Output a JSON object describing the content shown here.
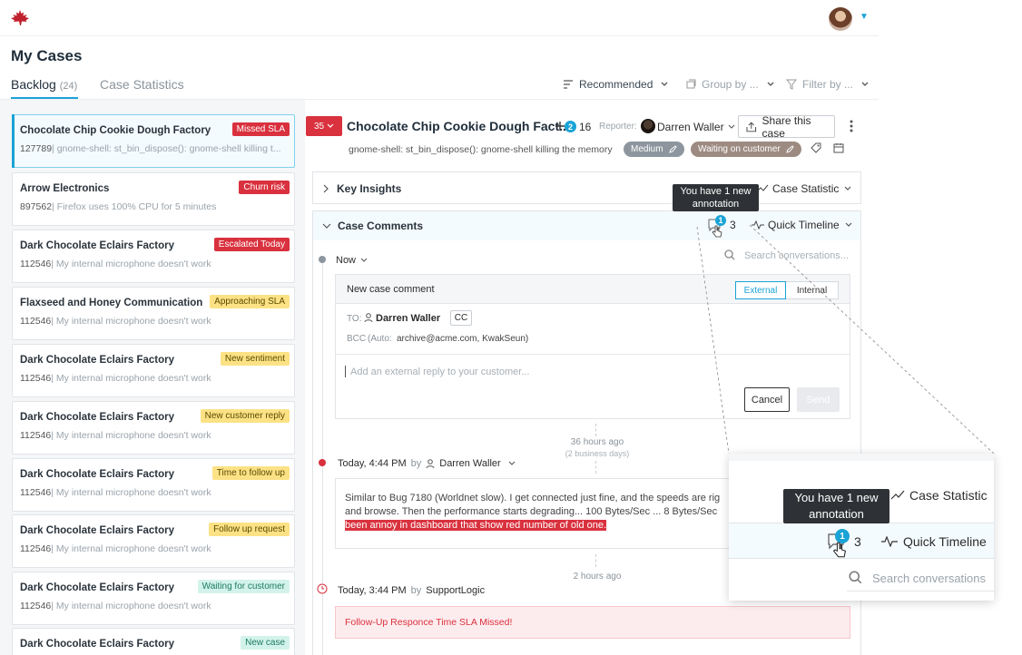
{
  "header": {
    "logo_icon": "maple-leaf-logo",
    "brand_color": "#d9313e",
    "accent_color": "#1aa3d6"
  },
  "page": {
    "title": "My Cases",
    "tabs": [
      {
        "label": "Backlog",
        "count": "(24)"
      },
      {
        "label": "Case Statistics"
      }
    ],
    "toolbar": {
      "sort_label": "Recommended",
      "group_label": "Group by ...",
      "filter_label": "Filter by ..."
    }
  },
  "cases": [
    {
      "title": "Chocolate Chip Cookie Dough Factory",
      "id": "127789",
      "desc": "gnome-shell: st_bin_dispose(): gnome-shell killing t...",
      "badge": "Missed SLA",
      "badge_type": "red"
    },
    {
      "title": "Arrow Electronics",
      "id": "897562",
      "desc": "Firefox uses 100% CPU for 5 minutes",
      "badge": "Churn risk",
      "badge_type": "red"
    },
    {
      "title": "Dark Chocolate Eclairs Factory",
      "id": "112546",
      "desc": "My internal microphone doesn't work",
      "badge": "Escalated Today",
      "badge_type": "red"
    },
    {
      "title": "Flaxseed and Honey Communication",
      "id": "112546",
      "desc": "My internal microphone doesn't work",
      "badge": "Approaching SLA",
      "badge_type": "yellow"
    },
    {
      "title": "Dark Chocolate Eclairs Factory",
      "id": "112546",
      "desc": "My internal microphone doesn't work",
      "badge": "New sentiment",
      "badge_type": "yellow"
    },
    {
      "title": "Dark Chocolate Eclairs Factory",
      "id": "112546",
      "desc": "My internal microphone doesn't work",
      "badge": "New customer reply",
      "badge_type": "yellow"
    },
    {
      "title": "Dark Chocolate Eclairs Factory",
      "id": "112546",
      "desc": "My internal microphone doesn't work",
      "badge": "Time to follow up",
      "badge_type": "yellow"
    },
    {
      "title": "Dark Chocolate Eclairs Factory",
      "id": "112546",
      "desc": "My internal microphone doesn't work",
      "badge": "Follow up request",
      "badge_type": "yellow"
    },
    {
      "title": "Dark Chocolate Eclairs Factory",
      "id": "112546",
      "desc": "My internal microphone doesn't work",
      "badge": "Waiting for customer",
      "badge_type": "green"
    },
    {
      "title": "Dark Chocolate Eclairs Factory",
      "id": "112546",
      "desc": "My internal microphone doesn't work",
      "badge": "New case",
      "badge_type": "green"
    }
  ],
  "detail": {
    "priority": "35",
    "title": "Chocolate Chip Cookie Dough Fact...",
    "watchers_badge": "2",
    "watchers_count": "16",
    "reporter_label": "Reporter:",
    "reporter_name": "Darren Waller",
    "share_label": "Share this case",
    "subtitle": "gnome-shell: st_bin_dispose(): gnome-shell killing the memory",
    "pill_severity": "Medium",
    "pill_status": "Waiting on customer",
    "key_insights_label": "Key Insights",
    "case_statistic_label": "Case Statistic",
    "case_comments_label": "Case Comments",
    "annotation_tooltip": "You have 1 new annotation",
    "annotation_badge": "1",
    "comment_count": "3",
    "quick_timeline_label": "Quick Timeline",
    "search_placeholder": "Search conversations...",
    "now_label": "Now",
    "new_comment": {
      "title": "New case comment",
      "external_label": "External",
      "internal_label": "Internal",
      "to_label": "TO:",
      "to_name": "Darren Waller",
      "cc_label": "CC",
      "bcc_label": "BCC",
      "bcc_auto": "(Auto:",
      "bcc_value": "archive@acme.com, KwakSeun)",
      "reply_placeholder": "Add an external reply to your customer...",
      "cancel_label": "Cancel",
      "send_label": "Send"
    },
    "gap1": {
      "ago": "36 hours ago",
      "business": "(2 business days)"
    },
    "event1": {
      "time": "Today, 4:44 PM",
      "by": "by",
      "author": "Darren Waller",
      "line1": "Similar to Bug 7180 (Worldnet slow).  I get connected just fine, and the speeds are rig",
      "line2": "and browse.  Then the performance starts degrading... 100 Bytes/Sec ...  8 Bytes/Sec",
      "highlight": "been annoy in dashboard that show red number of old one."
    },
    "gap2": {
      "ago": "2 hours ago"
    },
    "event2": {
      "time": "Today, 3:44 PM",
      "by": "by",
      "author": "SupportLogic",
      "message": "Follow-Up Responce Time SLA Missed!"
    }
  },
  "zoom": {
    "tooltip": "You have 1 new annotation",
    "badge": "1",
    "count": "3",
    "case_statistic_label": "Case Statistic",
    "quick_timeline_label": "Quick Timeline",
    "search_placeholder": "Search conversations"
  }
}
